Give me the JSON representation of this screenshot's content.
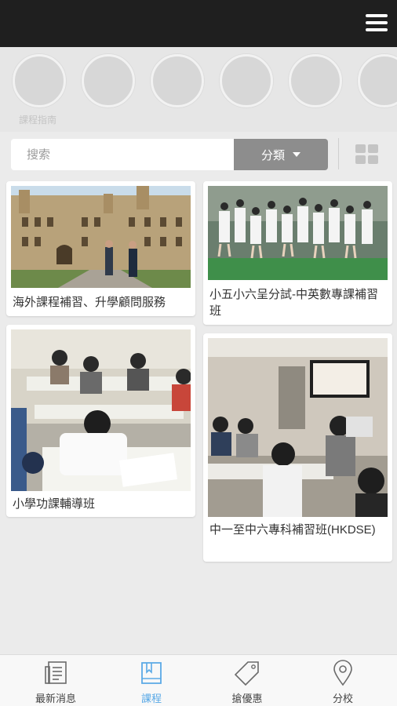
{
  "circles_strip": {
    "caption": "課程指南"
  },
  "search": {
    "placeholder": "搜索",
    "category_label": "分類"
  },
  "cards": [
    {
      "title": "海外課程補習、升學顧問服務",
      "image": "university-building-photo"
    },
    {
      "title": "小五小六呈分試-中英數專課補習班",
      "image": "students-jumping-photo"
    },
    {
      "title": "小學功課輔導班",
      "image": "primary-classroom-photo"
    },
    {
      "title": "中一至中六專科補習班(HKDSE)",
      "image": "secondary-classroom-photo"
    }
  ],
  "bottom_nav": {
    "items": [
      {
        "label": "最新消息",
        "icon": "newspaper-icon"
      },
      {
        "label": "課程",
        "icon": "book-icon",
        "active": true
      },
      {
        "label": "搶優惠",
        "icon": "tag-icon"
      },
      {
        "label": "分校",
        "icon": "location-pin-icon"
      }
    ]
  },
  "colors": {
    "topbar": "#1f1f1f",
    "accent": "#5aa9e6",
    "category_button": "#8d8d8d"
  }
}
